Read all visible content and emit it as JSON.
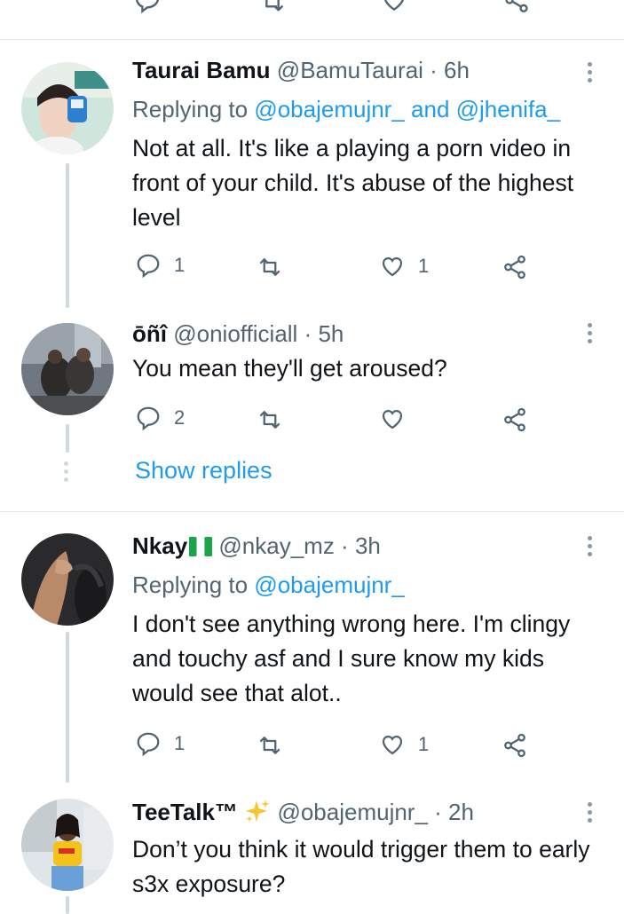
{
  "colors": {
    "link": "#1d9bf0",
    "secondary": "#536471",
    "divider": "#e3e7ea",
    "thread": "#cfd9de"
  },
  "tweets": [
    {
      "name": "Taurai Bamu",
      "handle": "@BamuTaurai",
      "time": "6h",
      "replying_prefix": "Replying to ",
      "replying_mentions": [
        "@obajemujnr_",
        "@jhenifa_"
      ],
      "replying_joiner": " and ",
      "text": "Not at all. It's like a playing a porn video in front of your child. It's abuse of the highest level",
      "reply_count": "1",
      "retweet_count": "",
      "like_count": "1"
    },
    {
      "name": "ōñî",
      "handle": "@oniofficiall",
      "time": "5h",
      "text": "You mean they'll get aroused?",
      "reply_count": "2",
      "retweet_count": "",
      "like_count": ""
    },
    {
      "name": "Nkay",
      "flag": "nigeria-flag",
      "handle": "@nkay_mz",
      "time": "3h",
      "replying_prefix": "Replying to ",
      "replying_mentions": [
        "@obajemujnr_"
      ],
      "text": "I don't see anything wrong here. I'm clingy and touchy asf and I sure know my kids would see that alot..",
      "reply_count": "1",
      "retweet_count": "",
      "like_count": "1"
    },
    {
      "name": "TeeTalk™",
      "emoji": "sparkles-icon",
      "handle": "@obajemujnr_",
      "time": "2h",
      "text": "Don’t you think it would trigger them to early s3x exposure?"
    }
  ],
  "show_replies": "Show replies",
  "separator": " · "
}
